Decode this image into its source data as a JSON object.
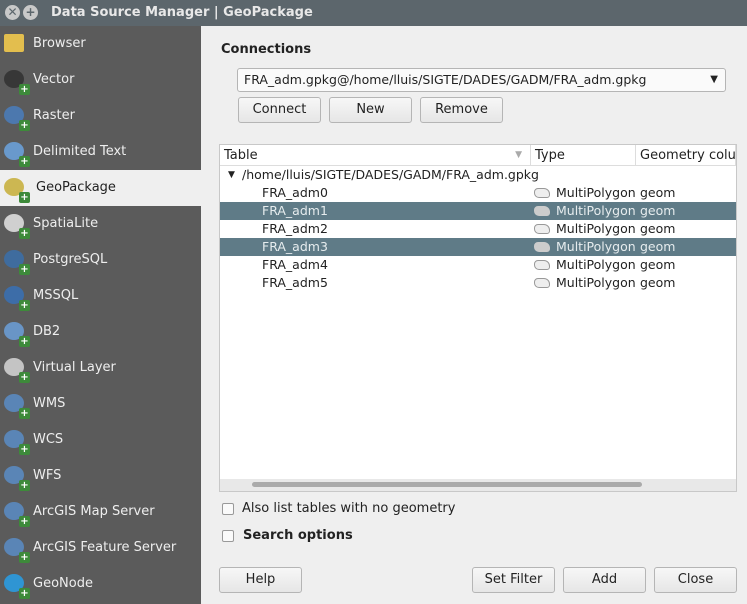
{
  "window": {
    "title": "Data Source Manager | GeoPackage"
  },
  "sidebar": {
    "items": [
      {
        "label": "Browser",
        "icon": "folder-icon"
      },
      {
        "label": "Vector",
        "icon": "vector-icon"
      },
      {
        "label": "Raster",
        "icon": "raster-icon"
      },
      {
        "label": "Delimited Text",
        "icon": "delimited-text-icon"
      },
      {
        "label": "GeoPackage",
        "icon": "geopackage-icon",
        "selected": true
      },
      {
        "label": "SpatiaLite",
        "icon": "spatialite-icon"
      },
      {
        "label": "PostgreSQL",
        "icon": "postgresql-icon"
      },
      {
        "label": "MSSQL",
        "icon": "mssql-icon"
      },
      {
        "label": "DB2",
        "icon": "db2-icon"
      },
      {
        "label": "Virtual Layer",
        "icon": "virtual-layer-icon"
      },
      {
        "label": "WMS",
        "icon": "wms-icon"
      },
      {
        "label": "WCS",
        "icon": "wcs-icon"
      },
      {
        "label": "WFS",
        "icon": "wfs-icon"
      },
      {
        "label": "ArcGIS Map Server",
        "icon": "arcgis-map-server-icon"
      },
      {
        "label": "ArcGIS Feature Server",
        "icon": "arcgis-feature-server-icon"
      },
      {
        "label": "GeoNode",
        "icon": "geonode-icon"
      }
    ]
  },
  "connections": {
    "label": "Connections",
    "selected": "FRA_adm.gpkg@/home/lluis/SIGTE/DADES/GADM/FRA_adm.gpkg",
    "connect": "Connect",
    "new": "New",
    "remove": "Remove"
  },
  "table": {
    "headers": [
      "Table",
      "Type",
      "Geometry colur"
    ],
    "root": "/home/lluis/SIGTE/DADES/GADM/FRA_adm.gpkg",
    "rows": [
      {
        "name": "FRA_adm0",
        "type": "MultiPolygon",
        "geom": "geom",
        "selected": false
      },
      {
        "name": "FRA_adm1",
        "type": "MultiPolygon",
        "geom": "geom",
        "selected": true
      },
      {
        "name": "FRA_adm2",
        "type": "MultiPolygon",
        "geom": "geom",
        "selected": false
      },
      {
        "name": "FRA_adm3",
        "type": "MultiPolygon",
        "geom": "geom",
        "selected": true
      },
      {
        "name": "FRA_adm4",
        "type": "MultiPolygon",
        "geom": "geom",
        "selected": false
      },
      {
        "name": "FRA_adm5",
        "type": "MultiPolygon",
        "geom": "geom",
        "selected": false
      }
    ]
  },
  "options": {
    "no_geometry": "Also list tables with no geometry",
    "no_geometry_checked": false,
    "search": "Search options",
    "search_checked": false
  },
  "footer": {
    "help": "Help",
    "set_filter": "Set Filter",
    "add": "Add",
    "close": "Close"
  },
  "colors": {
    "selection": "#5f7b87",
    "sidebar": "#5b5b5b",
    "titlebar": "#5c666c"
  }
}
